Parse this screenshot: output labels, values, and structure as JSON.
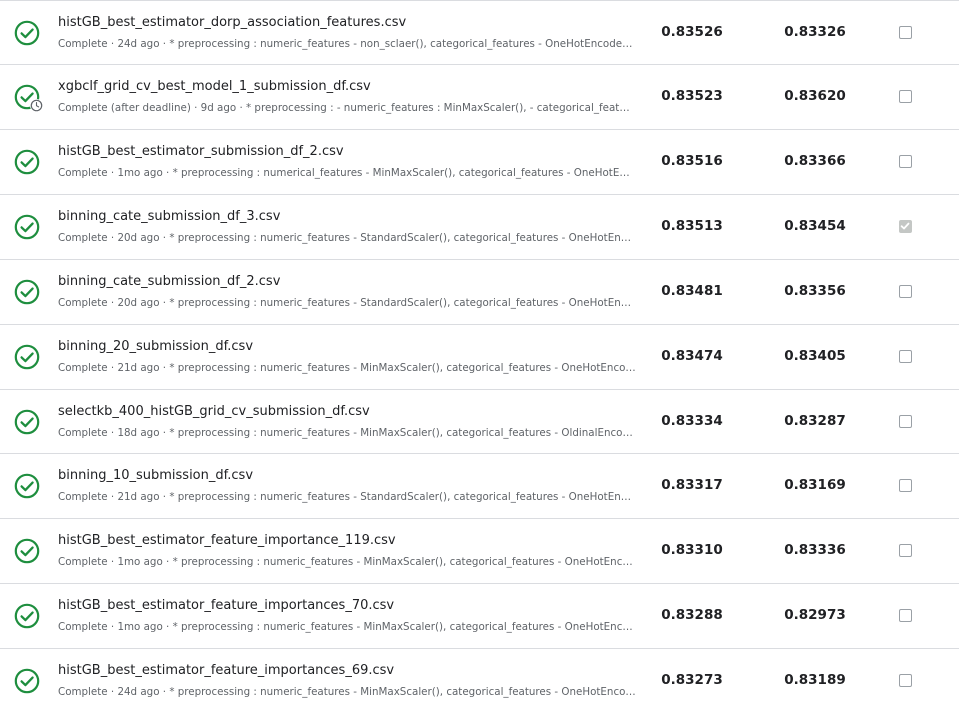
{
  "colors": {
    "success_green": "#1e8e3e",
    "checkbox_checked": "#c4c7c5",
    "text_primary": "#202124",
    "text_secondary": "#5f6368"
  },
  "submissions": [
    {
      "filename": "histGB_best_estimator_dorp_association_features.csv",
      "description": "Complete · 24d ago · * preprocessing : numeric_features - non_sclaer(), categorical_features - OneHotEncoder() * feature...",
      "private_score": "0.83526",
      "public_score": "0.83326",
      "selected": false,
      "status_icon": "check-circle-icon",
      "late": false
    },
    {
      "filename": "xgbclf_grid_cv_best_model_1_submission_df.csv",
      "description": "Complete (after deadline) · 9d ago · * preprocessing : - numeric_features : MinMaxScaler(), - categorical_features : OneH...",
      "private_score": "0.83523",
      "public_score": "0.83620",
      "selected": false,
      "status_icon": "check-circle-icon",
      "late": true
    },
    {
      "filename": "histGB_best_estimator_submission_df_2.csv",
      "description": "Complete · 1mo ago · * preprocessing : numerical_features - MinMaxScaler(), categorical_features - OneHotEncoder() * m...",
      "private_score": "0.83516",
      "public_score": "0.83366",
      "selected": false,
      "status_icon": "check-circle-icon",
      "late": false
    },
    {
      "filename": "binning_cate_submission_df_3.csv",
      "description": "Complete · 20d ago · * preprocessing : numeric_features - StandardScaler(), categorical_features - OneHotEncoder() * fe...",
      "private_score": "0.83513",
      "public_score": "0.83454",
      "selected": true,
      "status_icon": "check-circle-icon",
      "late": false
    },
    {
      "filename": "binning_cate_submission_df_2.csv",
      "description": "Complete · 20d ago · * preprocessing : numeric_features - StandardScaler(), categorical_features - OneHotEncoder() * fe...",
      "private_score": "0.83481",
      "public_score": "0.83356",
      "selected": false,
      "status_icon": "check-circle-icon",
      "late": false
    },
    {
      "filename": "binning_20_submission_df.csv",
      "description": "Complete · 21d ago · * preprocessing : numeric_features - MinMaxScaler(), categorical_features - OneHotEncoder() * feat...",
      "private_score": "0.83474",
      "public_score": "0.83405",
      "selected": false,
      "status_icon": "check-circle-icon",
      "late": false
    },
    {
      "filename": "selectkb_400_histGB_grid_cv_submission_df.csv",
      "description": "Complete · 18d ago · * preprocessing : numeric_features - MinMaxScaler(), categorical_features - OldinalEncoder() * feat...",
      "private_score": "0.83334",
      "public_score": "0.83287",
      "selected": false,
      "status_icon": "check-circle-icon",
      "late": false
    },
    {
      "filename": "binning_10_submission_df.csv",
      "description": "Complete · 21d ago · * preprocessing : numeric_features - StandardScaler(), categorical_features - OneHotEncoder() * fe...",
      "private_score": "0.83317",
      "public_score": "0.83169",
      "selected": false,
      "status_icon": "check-circle-icon",
      "late": false
    },
    {
      "filename": "histGB_best_estimator_feature_importance_119.csv",
      "description": "Complete · 1mo ago · * preprocessing : numeric_features - MinMaxScaler(), categorical_features - OneHotEncoder() * fea...",
      "private_score": "0.83310",
      "public_score": "0.83336",
      "selected": false,
      "status_icon": "check-circle-icon",
      "late": false
    },
    {
      "filename": "histGB_best_estimator_feature_importances_70.csv",
      "description": "Complete · 1mo ago · * preprocessing : numeric_features - MinMaxScaler(), categorical_features - OneHotEncoder() * fea...",
      "private_score": "0.83288",
      "public_score": "0.82973",
      "selected": false,
      "status_icon": "check-circle-icon",
      "late": false
    },
    {
      "filename": "histGB_best_estimator_feature_importances_69.csv",
      "description": "Complete · 24d ago · * preprocessing : numeric_features - MinMaxScaler(), categorical_features - OneHotEncoder() * fea...",
      "private_score": "0.83273",
      "public_score": "0.83189",
      "selected": false,
      "status_icon": "check-circle-icon",
      "late": false
    }
  ]
}
